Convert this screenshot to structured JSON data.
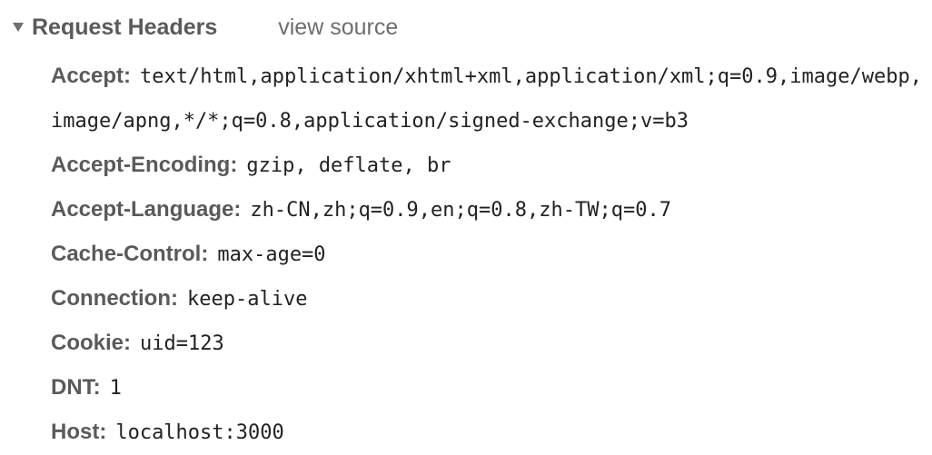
{
  "section": {
    "title": "Request Headers",
    "view_source_label": "view source",
    "toggle_icon": "disclosure-triangle-down"
  },
  "headers": [
    {
      "name": "Accept:",
      "value": "text/html,application/xhtml+xml,application/xml;q=0.9,image/webp,image/apng,*/*;q=0.8,application/signed-exchange;v=b3"
    },
    {
      "name": "Accept-Encoding:",
      "value": "gzip, deflate, br"
    },
    {
      "name": "Accept-Language:",
      "value": "zh-CN,zh;q=0.9,en;q=0.8,zh-TW;q=0.7"
    },
    {
      "name": "Cache-Control:",
      "value": "max-age=0"
    },
    {
      "name": "Connection:",
      "value": "keep-alive"
    },
    {
      "name": "Cookie:",
      "value": "uid=123"
    },
    {
      "name": "DNT:",
      "value": "1"
    },
    {
      "name": "Host:",
      "value": "localhost:3000"
    }
  ]
}
